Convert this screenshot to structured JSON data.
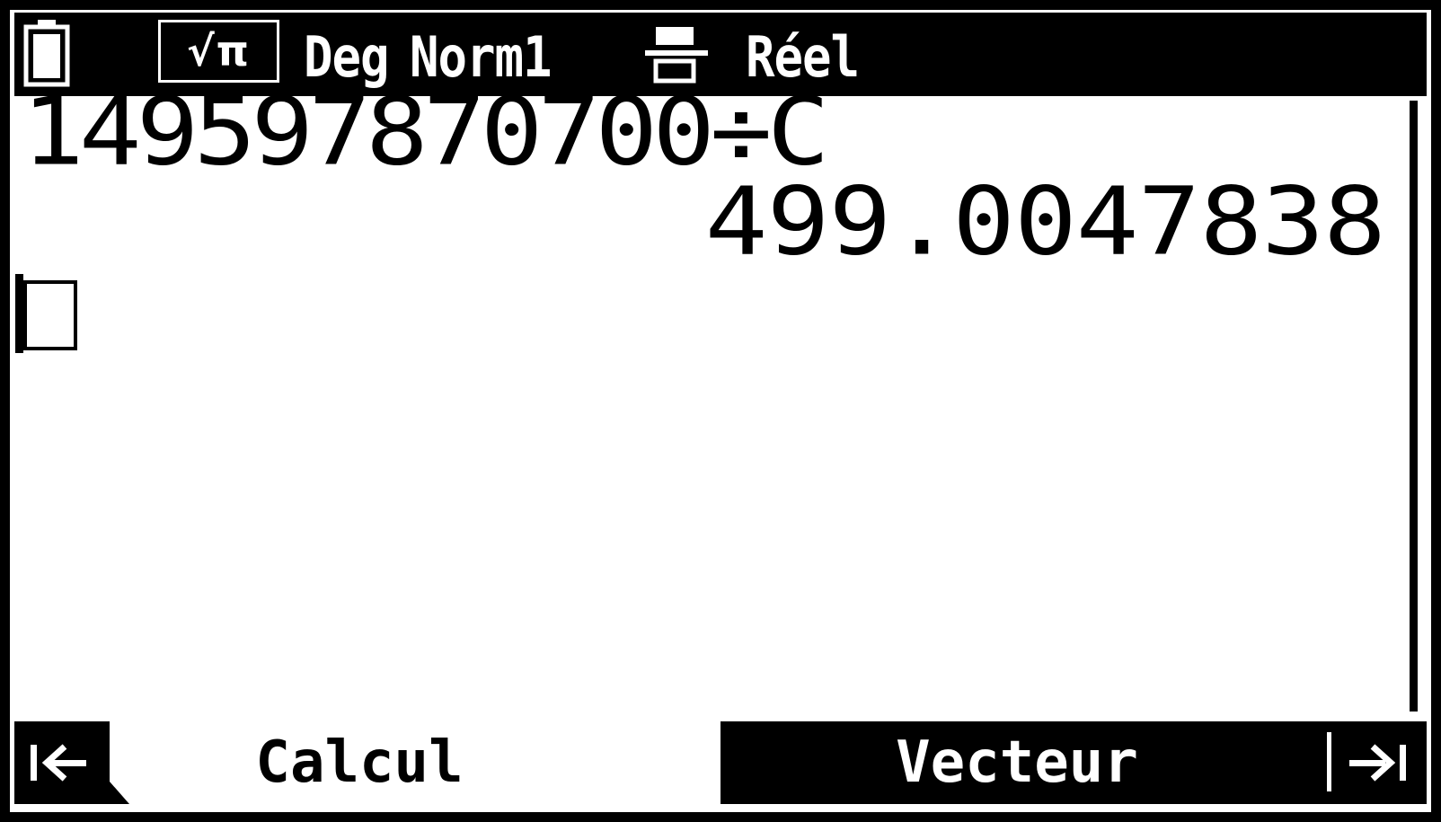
{
  "status_bar": {
    "battery_icon": "battery-icon",
    "mode_label": "√π",
    "angle_mode": "Deg",
    "display_mode": "Norm1",
    "fraction_icon": "fraction-format-icon",
    "number_mode": "Réel"
  },
  "history": {
    "expression": "149597870700÷C",
    "result": "499.0047838"
  },
  "tabs": {
    "left_nav_icon": "arrow-left-to-bar-icon",
    "calcul": "Calcul",
    "vecteur": "Vecteur",
    "right_nav_icon": "arrow-right-to-bar-icon"
  },
  "colors": {
    "foreground": "#000000",
    "background": "#ffffff"
  }
}
